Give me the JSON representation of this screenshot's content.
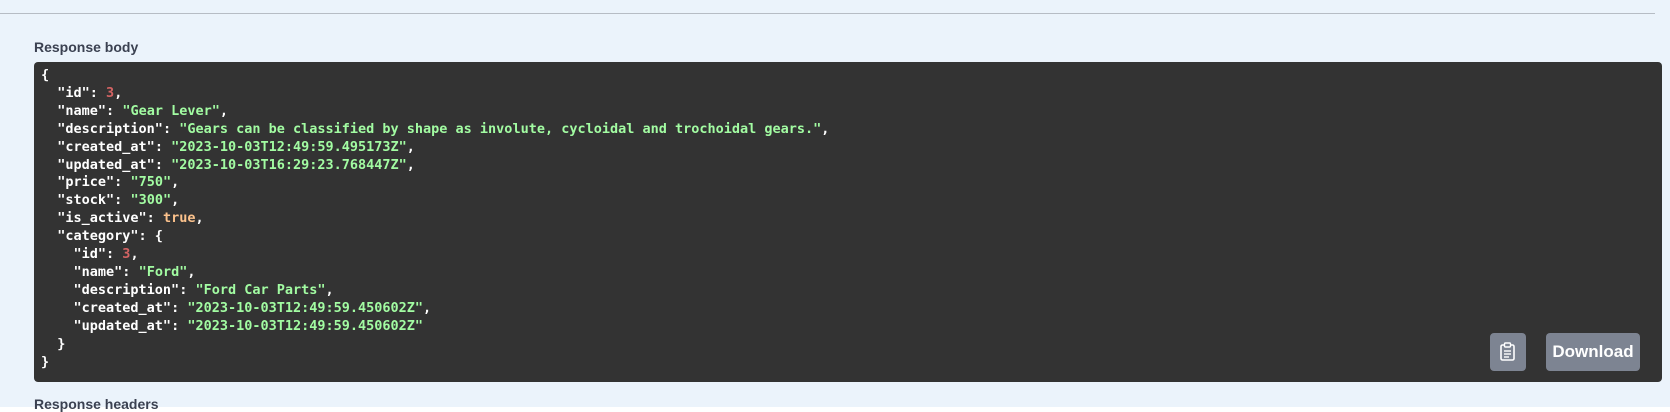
{
  "response_body": {
    "label": "Response body",
    "json_lines": [
      [
        {
          "t": "p",
          "v": "{"
        }
      ],
      [
        {
          "t": "p",
          "v": "  "
        },
        {
          "t": "k",
          "v": "\"id\""
        },
        {
          "t": "p",
          "v": ": "
        },
        {
          "t": "n",
          "v": "3"
        },
        {
          "t": "p",
          "v": ","
        }
      ],
      [
        {
          "t": "p",
          "v": "  "
        },
        {
          "t": "k",
          "v": "\"name\""
        },
        {
          "t": "p",
          "v": ": "
        },
        {
          "t": "s",
          "v": "\"Gear Lever\""
        },
        {
          "t": "p",
          "v": ","
        }
      ],
      [
        {
          "t": "p",
          "v": "  "
        },
        {
          "t": "k",
          "v": "\"description\""
        },
        {
          "t": "p",
          "v": ": "
        },
        {
          "t": "s",
          "v": "\"Gears can be classified by shape as involute, cycloidal and trochoidal gears.\""
        },
        {
          "t": "p",
          "v": ","
        }
      ],
      [
        {
          "t": "p",
          "v": "  "
        },
        {
          "t": "k",
          "v": "\"created_at\""
        },
        {
          "t": "p",
          "v": ": "
        },
        {
          "t": "s",
          "v": "\"2023-10-03T12:49:59.495173Z\""
        },
        {
          "t": "p",
          "v": ","
        }
      ],
      [
        {
          "t": "p",
          "v": "  "
        },
        {
          "t": "k",
          "v": "\"updated_at\""
        },
        {
          "t": "p",
          "v": ": "
        },
        {
          "t": "s",
          "v": "\"2023-10-03T16:29:23.768447Z\""
        },
        {
          "t": "p",
          "v": ","
        }
      ],
      [
        {
          "t": "p",
          "v": "  "
        },
        {
          "t": "k",
          "v": "\"price\""
        },
        {
          "t": "p",
          "v": ": "
        },
        {
          "t": "s",
          "v": "\"750\""
        },
        {
          "t": "p",
          "v": ","
        }
      ],
      [
        {
          "t": "p",
          "v": "  "
        },
        {
          "t": "k",
          "v": "\"stock\""
        },
        {
          "t": "p",
          "v": ": "
        },
        {
          "t": "s",
          "v": "\"300\""
        },
        {
          "t": "p",
          "v": ","
        }
      ],
      [
        {
          "t": "p",
          "v": "  "
        },
        {
          "t": "k",
          "v": "\"is_active\""
        },
        {
          "t": "p",
          "v": ": "
        },
        {
          "t": "b",
          "v": "true"
        },
        {
          "t": "p",
          "v": ","
        }
      ],
      [
        {
          "t": "p",
          "v": "  "
        },
        {
          "t": "k",
          "v": "\"category\""
        },
        {
          "t": "p",
          "v": ": {"
        }
      ],
      [
        {
          "t": "p",
          "v": "    "
        },
        {
          "t": "k",
          "v": "\"id\""
        },
        {
          "t": "p",
          "v": ": "
        },
        {
          "t": "n",
          "v": "3"
        },
        {
          "t": "p",
          "v": ","
        }
      ],
      [
        {
          "t": "p",
          "v": "    "
        },
        {
          "t": "k",
          "v": "\"name\""
        },
        {
          "t": "p",
          "v": ": "
        },
        {
          "t": "s",
          "v": "\"Ford\""
        },
        {
          "t": "p",
          "v": ","
        }
      ],
      [
        {
          "t": "p",
          "v": "    "
        },
        {
          "t": "k",
          "v": "\"description\""
        },
        {
          "t": "p",
          "v": ": "
        },
        {
          "t": "s",
          "v": "\"Ford Car Parts\""
        },
        {
          "t": "p",
          "v": ","
        }
      ],
      [
        {
          "t": "p",
          "v": "    "
        },
        {
          "t": "k",
          "v": "\"created_at\""
        },
        {
          "t": "p",
          "v": ": "
        },
        {
          "t": "s",
          "v": "\"2023-10-03T12:49:59.450602Z\""
        },
        {
          "t": "p",
          "v": ","
        }
      ],
      [
        {
          "t": "p",
          "v": "    "
        },
        {
          "t": "k",
          "v": "\"updated_at\""
        },
        {
          "t": "p",
          "v": ": "
        },
        {
          "t": "s",
          "v": "\"2023-10-03T12:49:59.450602Z\""
        }
      ],
      [
        {
          "t": "p",
          "v": "  }"
        }
      ],
      [
        {
          "t": "p",
          "v": "}"
        }
      ]
    ],
    "copy_button": {
      "icon": "clipboard-icon"
    },
    "download_button": {
      "label": "Download"
    }
  },
  "response_headers": {
    "label": "Response headers"
  },
  "colors": {
    "panel_background": "#ebf3fb",
    "code_background": "#333333",
    "json_key": "#ffffff",
    "json_string": "#a2fca2",
    "json_number": "#d36363",
    "json_boolean": "#fcc28c",
    "button_background": "#7d8492"
  }
}
